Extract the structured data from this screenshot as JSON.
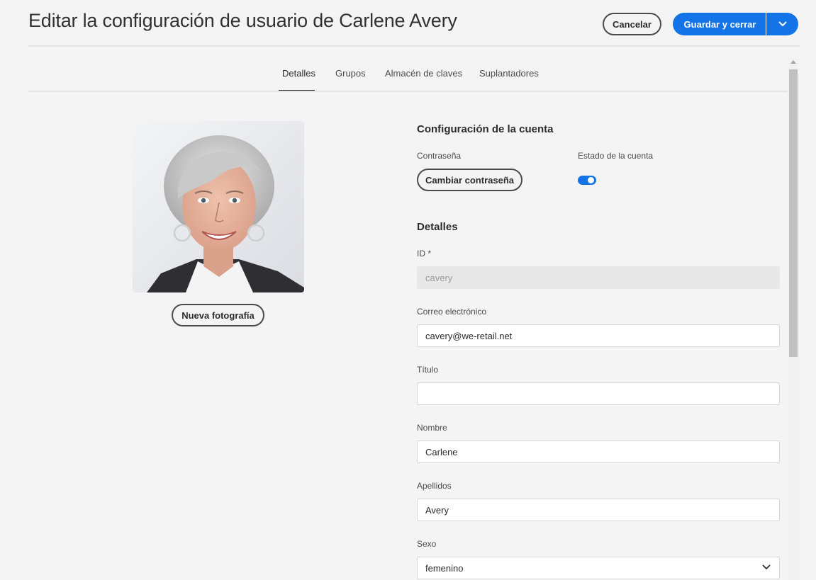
{
  "header": {
    "title": "Editar la configuración de usuario de Carlene Avery",
    "cancel_label": "Cancelar",
    "save_label": "Guardar y cerrar",
    "dropdown_icon": "chevron-down-icon"
  },
  "tabs": [
    {
      "label": "Detalles",
      "active": true
    },
    {
      "label": "Grupos",
      "active": false
    },
    {
      "label": "Almacén de claves",
      "active": false
    },
    {
      "label": "Suplantadores",
      "active": false
    }
  ],
  "photo": {
    "new_photo_label": "Nueva fotografía"
  },
  "account": {
    "section_title": "Configuración de la cuenta",
    "password_label": "Contraseña",
    "change_password_label": "Cambiar contraseña",
    "status_label": "Estado de la cuenta",
    "status_enabled": true
  },
  "details": {
    "section_title": "Detalles",
    "id_label": "ID *",
    "id_value": "cavery",
    "email_label": "Correo electrónico",
    "email_value": "cavery@we-retail.net",
    "title_label": "Título",
    "title_value": "",
    "first_name_label": "Nombre",
    "first_name_value": "Carlene",
    "last_name_label": "Apellidos",
    "last_name_value": "Avery",
    "gender_label": "Sexo",
    "gender_value": "femenino"
  },
  "colors": {
    "accent": "#1473e6",
    "background": "#f4f4f4"
  }
}
